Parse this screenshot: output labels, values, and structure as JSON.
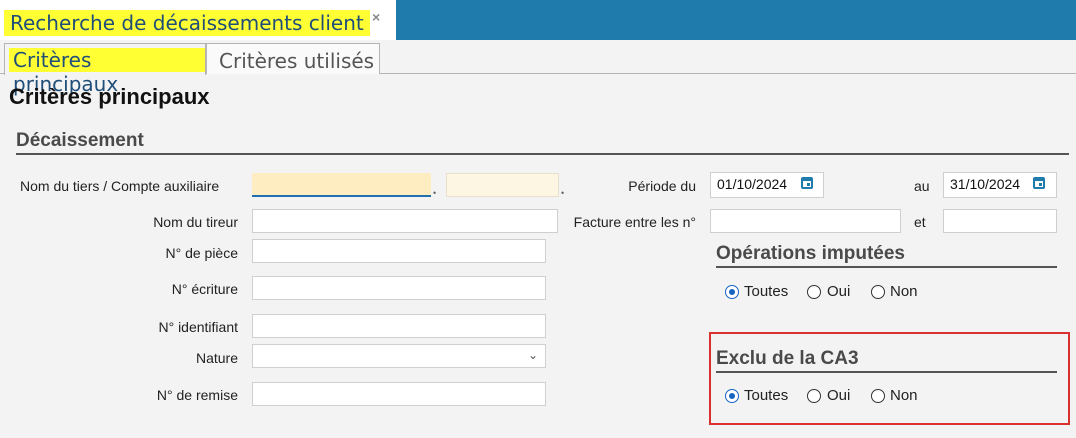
{
  "window": {
    "tab_title": "Recherche de décaissements client",
    "close_glyph": "×"
  },
  "subtabs": [
    {
      "label": "Critères principaux",
      "active": true
    },
    {
      "label": "Critères utilisés",
      "active": false
    }
  ],
  "page_title": "Critères principaux",
  "decaissement": {
    "title": "Décaissement",
    "fields": {
      "nom_tiers": {
        "label": "Nom du tiers / Compte auxiliaire",
        "value1": "",
        "value2": ""
      },
      "nom_tireur": {
        "label": "Nom du tireur",
        "value": ""
      },
      "piece": {
        "label": "N° de pièce",
        "value": ""
      },
      "ecriture": {
        "label": "N° écriture",
        "value": ""
      },
      "identifiant": {
        "label": "N° identifiant",
        "value": ""
      },
      "nature": {
        "label": "Nature",
        "value": ""
      },
      "remise": {
        "label": "N° de remise",
        "value": ""
      }
    },
    "periode": {
      "label": "Période du",
      "from": "01/10/2024",
      "to_label": "au",
      "to": "31/10/2024"
    },
    "facture": {
      "label": "Facture entre les n°",
      "from": "",
      "and_label": "et",
      "to": ""
    }
  },
  "operations_imputees": {
    "title": "Opérations imputées",
    "options": [
      "Toutes",
      "Oui",
      "Non"
    ],
    "selected": "Toutes"
  },
  "exclu_ca3": {
    "title": "Exclu de la CA3",
    "options": [
      "Toutes",
      "Oui",
      "Non"
    ],
    "selected": "Toutes",
    "highlight_color": "#d93030"
  },
  "colors": {
    "accent": "#1f7bab",
    "highlight": "#ffff33",
    "radio_selected": "#1565c0"
  }
}
